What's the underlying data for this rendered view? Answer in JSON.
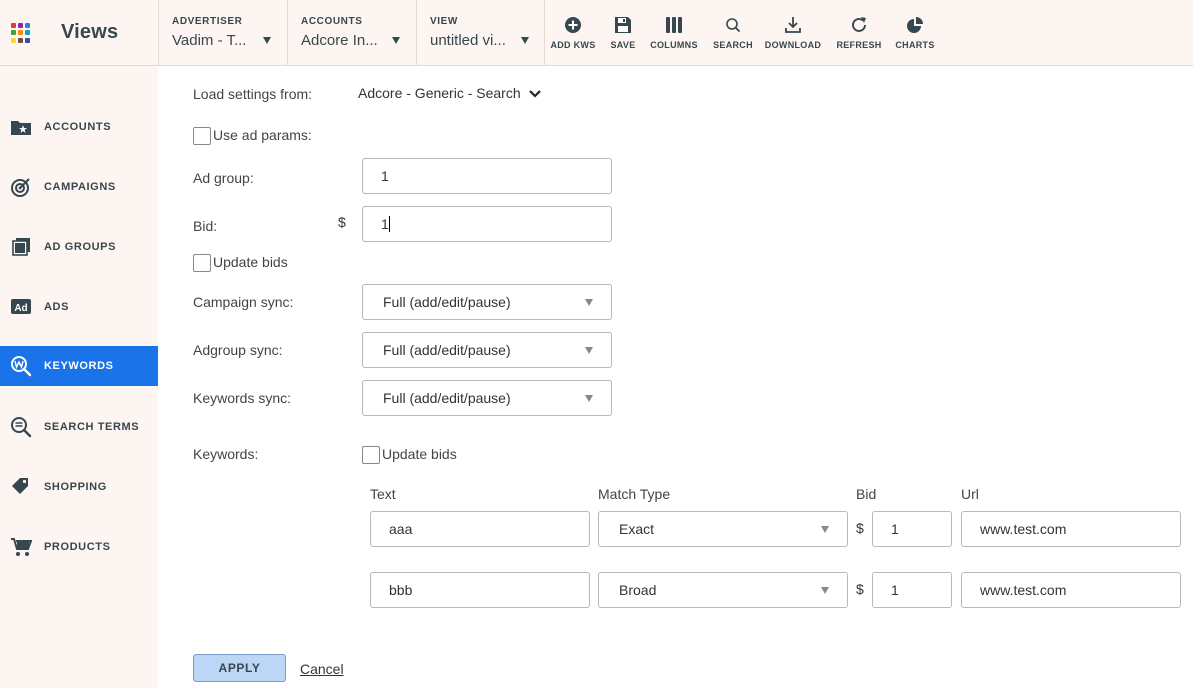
{
  "app": {
    "title": "Views"
  },
  "app_grid_colors": [
    "#e53935",
    "#8e24aa",
    "#1e88e5",
    "#43a047",
    "#fb8c00",
    "#00acc1",
    "#fdd835",
    "#6d4c41",
    "#3949ab"
  ],
  "topbar": {
    "advertiser": {
      "label": "ADVERTISER",
      "value": "Vadim - T..."
    },
    "accounts": {
      "label": "ACCOUNTS",
      "value": "Adcore In..."
    },
    "view": {
      "label": "VIEW",
      "value": "untitled vi..."
    },
    "tools": [
      {
        "label": "ADD KWS",
        "icon": "plus-circle-icon"
      },
      {
        "label": "SAVE",
        "icon": "floppy-disk-icon"
      },
      {
        "label": "COLUMNS",
        "icon": "columns-icon"
      },
      {
        "label": "SEARCH",
        "icon": "search-icon"
      },
      {
        "label": "DOWNLOAD",
        "icon": "download-icon"
      },
      {
        "label": "REFRESH",
        "icon": "refresh-icon"
      },
      {
        "label": "CHARTS",
        "icon": "pie-chart-icon"
      }
    ]
  },
  "sidebar": {
    "items": [
      {
        "label": "ACCOUNTS",
        "icon": "folder-star-icon",
        "active": false
      },
      {
        "label": "CAMPAIGNS",
        "icon": "target-icon",
        "active": false
      },
      {
        "label": "AD GROUPS",
        "icon": "stacked-pages-icon",
        "active": false
      },
      {
        "label": "ADS",
        "icon": "ad-badge-icon",
        "active": false
      },
      {
        "label": "KEYWORDS",
        "icon": "keyword-search-icon",
        "active": true
      },
      {
        "label": "SEARCH TERMS",
        "icon": "search-list-icon",
        "active": false
      },
      {
        "label": "SHOPPING",
        "icon": "tag-icon",
        "active": false
      },
      {
        "label": "PRODUCTS",
        "icon": "cart-icon",
        "active": false
      }
    ],
    "active_color": "#1a73e8"
  },
  "form": {
    "load_settings_label": "Load settings from:",
    "load_settings_value": "Adcore - Generic - Search",
    "use_ad_params_label": "Use ad params:",
    "ad_group_label": "Ad group:",
    "ad_group_value": "1",
    "bid_label": "Bid:",
    "currency_symbol": "$",
    "bid_value": "1",
    "update_bids_label": "Update bids",
    "campaign_sync_label": "Campaign sync:",
    "campaign_sync_value": "Full (add/edit/pause)",
    "adgroup_sync_label": "Adgroup sync:",
    "adgroup_sync_value": "Full (add/edit/pause)",
    "keywords_sync_label": "Keywords sync:",
    "keywords_sync_value": "Full (add/edit/pause)",
    "keywords_label": "Keywords:",
    "keywords_update_bids_label": "Update bids"
  },
  "keywords_table": {
    "headers": {
      "text": "Text",
      "match_type": "Match Type",
      "bid": "Bid",
      "url": "Url"
    },
    "rows": [
      {
        "text": "aaa",
        "match_type": "Exact",
        "currency": "$",
        "bid": "1",
        "url": "www.test.com"
      },
      {
        "text": "bbb",
        "match_type": "Broad",
        "currency": "$",
        "bid": "1",
        "url": "www.test.com"
      }
    ]
  },
  "actions": {
    "apply_label": "APPLY",
    "cancel_label": "Cancel"
  }
}
